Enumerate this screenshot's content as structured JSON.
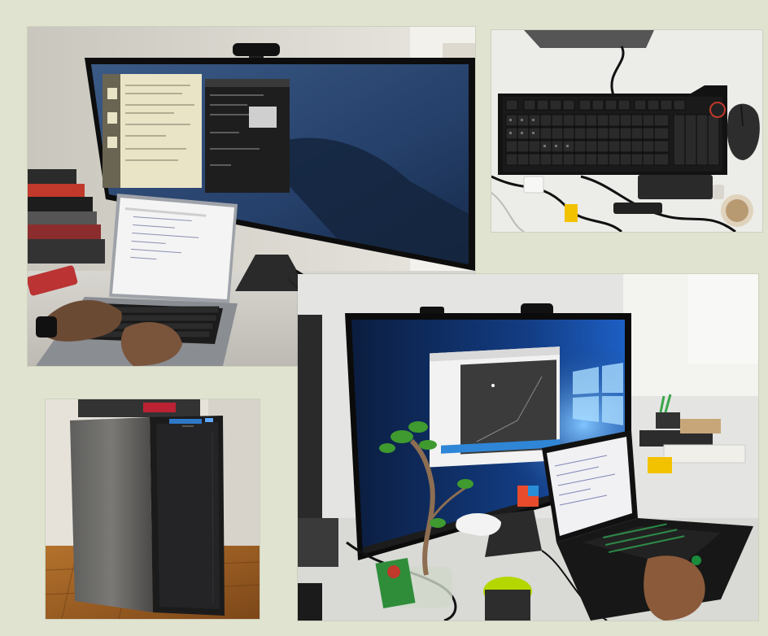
{
  "collage": {
    "background": "#dfe3cf",
    "photos": [
      {
        "id": "desk",
        "icon": "ultrawide-monitor-macbook-photo"
      },
      {
        "id": "keyboard",
        "icon": "mechanical-keyboard-photo"
      },
      {
        "id": "tower",
        "icon": "pc-tower-case-photo"
      },
      {
        "id": "windows",
        "icon": "windows-workstation-photo"
      }
    ]
  }
}
